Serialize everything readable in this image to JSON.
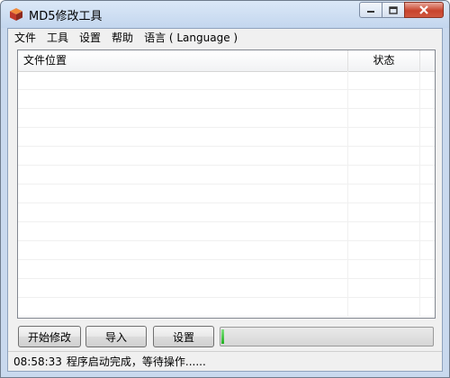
{
  "window": {
    "title": "MD5修改工具"
  },
  "menu": [
    "文件",
    "工具",
    "设置",
    "帮助",
    "语言 ( Language )"
  ],
  "list": {
    "columns": [
      "文件位置",
      "状态"
    ],
    "rows": []
  },
  "buttons": {
    "start": "开始修改",
    "import": "导入",
    "settings": "设置"
  },
  "progress": {
    "value": 0.01
  },
  "status": {
    "time": "08:58:33",
    "message": "程序启动完成，等待操作......"
  },
  "colors": {
    "progress_fill": "#22b022",
    "titlebar": "#c3d6ee",
    "close_button": "#c8442d"
  }
}
